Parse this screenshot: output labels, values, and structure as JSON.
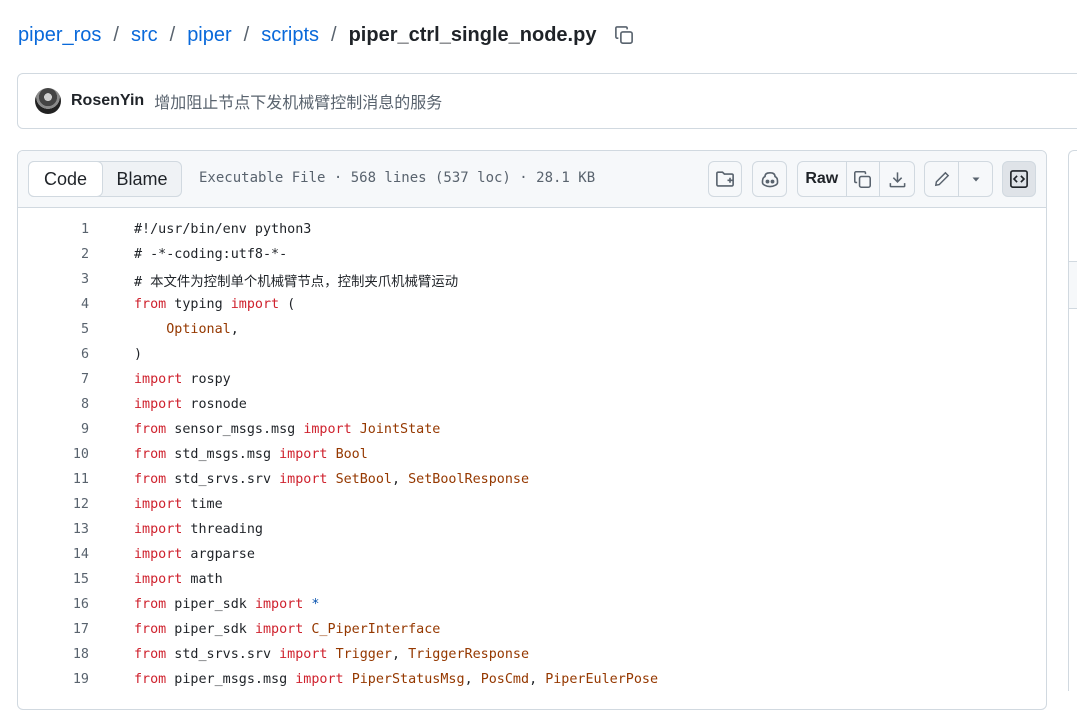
{
  "breadcrumb": {
    "segments": [
      "piper_ros",
      "src",
      "piper",
      "scripts"
    ],
    "separator": "/",
    "file_name": "piper_ctrl_single_node.py",
    "copy_icon": "copy-icon"
  },
  "commit": {
    "author": "RosenYin",
    "message": "增加阻止节点下发机械臂控制消息的服务"
  },
  "file_header": {
    "tabs": [
      "Code",
      "Blame"
    ],
    "active_tab": "Code",
    "meta": "Executable File · 568 lines (537 loc) · 28.1 KB",
    "raw_label": "Raw",
    "icons": [
      "file-directory-icon",
      "copilot-icon",
      "copy-icon",
      "download-icon",
      "pencil-icon",
      "triangle-down-icon",
      "code-square-icon"
    ]
  },
  "code_lines": [
    {
      "n": "1",
      "tokens": [
        {
          "t": "#!/usr/bin/env python3",
          "c": "plain"
        }
      ]
    },
    {
      "n": "2",
      "tokens": [
        {
          "t": "# -*-coding:utf8-*-",
          "c": "plain"
        }
      ]
    },
    {
      "n": "3",
      "tokens": [
        {
          "t": "# 本文件为控制单个机械臂节点，控制夹爪机械臂运动",
          "c": "plain"
        }
      ]
    },
    {
      "n": "4",
      "tokens": [
        {
          "t": "from",
          "c": "kw"
        },
        {
          "t": " typing ",
          "c": "plain"
        },
        {
          "t": "import",
          "c": "kw"
        },
        {
          "t": " (",
          "c": "plain"
        }
      ]
    },
    {
      "n": "5",
      "tokens": [
        {
          "t": "    ",
          "c": "plain"
        },
        {
          "t": "Optional",
          "c": "nm"
        },
        {
          "t": ",",
          "c": "plain"
        }
      ]
    },
    {
      "n": "6",
      "tokens": [
        {
          "t": ")",
          "c": "plain"
        }
      ]
    },
    {
      "n": "7",
      "tokens": [
        {
          "t": "import",
          "c": "kw"
        },
        {
          "t": " rospy",
          "c": "plain"
        }
      ]
    },
    {
      "n": "8",
      "tokens": [
        {
          "t": "import",
          "c": "kw"
        },
        {
          "t": " rosnode",
          "c": "plain"
        }
      ]
    },
    {
      "n": "9",
      "tokens": [
        {
          "t": "from",
          "c": "kw"
        },
        {
          "t": " sensor_msgs.msg ",
          "c": "plain"
        },
        {
          "t": "import",
          "c": "kw"
        },
        {
          "t": " ",
          "c": "plain"
        },
        {
          "t": "JointState",
          "c": "nm"
        }
      ]
    },
    {
      "n": "10",
      "tokens": [
        {
          "t": "from",
          "c": "kw"
        },
        {
          "t": " std_msgs.msg ",
          "c": "plain"
        },
        {
          "t": "import",
          "c": "kw"
        },
        {
          "t": " ",
          "c": "plain"
        },
        {
          "t": "Bool",
          "c": "nm"
        }
      ]
    },
    {
      "n": "11",
      "tokens": [
        {
          "t": "from",
          "c": "kw"
        },
        {
          "t": " std_srvs.srv ",
          "c": "plain"
        },
        {
          "t": "import",
          "c": "kw"
        },
        {
          "t": " ",
          "c": "plain"
        },
        {
          "t": "SetBool",
          "c": "nm"
        },
        {
          "t": ", ",
          "c": "plain"
        },
        {
          "t": "SetBoolResponse",
          "c": "nm"
        }
      ]
    },
    {
      "n": "12",
      "tokens": [
        {
          "t": "import",
          "c": "kw"
        },
        {
          "t": " time",
          "c": "plain"
        }
      ]
    },
    {
      "n": "13",
      "tokens": [
        {
          "t": "import",
          "c": "kw"
        },
        {
          "t": " threading",
          "c": "plain"
        }
      ]
    },
    {
      "n": "14",
      "tokens": [
        {
          "t": "import",
          "c": "kw"
        },
        {
          "t": " argparse",
          "c": "plain"
        }
      ]
    },
    {
      "n": "15",
      "tokens": [
        {
          "t": "import",
          "c": "kw"
        },
        {
          "t": " math",
          "c": "plain"
        }
      ]
    },
    {
      "n": "16",
      "tokens": [
        {
          "t": "from",
          "c": "kw"
        },
        {
          "t": " piper_sdk ",
          "c": "plain"
        },
        {
          "t": "import",
          "c": "kw"
        },
        {
          "t": " ",
          "c": "plain"
        },
        {
          "t": "*",
          "c": "op"
        }
      ]
    },
    {
      "n": "17",
      "tokens": [
        {
          "t": "from",
          "c": "kw"
        },
        {
          "t": " piper_sdk ",
          "c": "plain"
        },
        {
          "t": "import",
          "c": "kw"
        },
        {
          "t": " ",
          "c": "plain"
        },
        {
          "t": "C_PiperInterface",
          "c": "nm"
        }
      ]
    },
    {
      "n": "18",
      "tokens": [
        {
          "t": "from",
          "c": "kw"
        },
        {
          "t": " std_srvs.srv ",
          "c": "plain"
        },
        {
          "t": "import",
          "c": "kw"
        },
        {
          "t": " ",
          "c": "plain"
        },
        {
          "t": "Trigger",
          "c": "nm"
        },
        {
          "t": ", ",
          "c": "plain"
        },
        {
          "t": "TriggerResponse",
          "c": "nm"
        }
      ]
    },
    {
      "n": "19",
      "tokens": [
        {
          "t": "from",
          "c": "kw"
        },
        {
          "t": " piper_msgs.msg ",
          "c": "plain"
        },
        {
          "t": "import",
          "c": "kw"
        },
        {
          "t": " ",
          "c": "plain"
        },
        {
          "t": "PiperStatusMsg",
          "c": "nm"
        },
        {
          "t": ", ",
          "c": "plain"
        },
        {
          "t": "PosCmd",
          "c": "nm"
        },
        {
          "t": ", ",
          "c": "plain"
        },
        {
          "t": "PiperEulerPose",
          "c": "nm"
        }
      ]
    }
  ],
  "colors": {
    "link": "#0969da",
    "keyword": "#cf222e",
    "name": "#953800",
    "operator": "#0550ae",
    "line_number": "#59636e",
    "header_bg": "#f6f8fa",
    "border": "#d1d9e0"
  }
}
